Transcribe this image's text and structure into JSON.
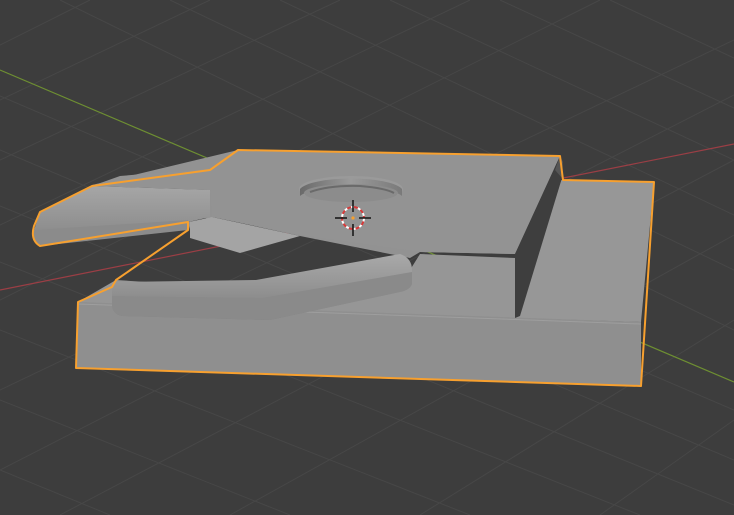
{
  "viewport": {
    "background_color": "#3d3d3d",
    "grid_line_color": "#464646",
    "x_axis_color": "#9b3e45",
    "y_axis_color": "#6e8f32",
    "selection_outline_color": "#f7a02f",
    "mesh_shade_top": "#949494",
    "mesh_shade_front": "#8e8e8e",
    "mesh_shade_dark": "#3e3e3e",
    "cursor": "3d-cursor-icon",
    "selected_object": "mesh-object"
  }
}
